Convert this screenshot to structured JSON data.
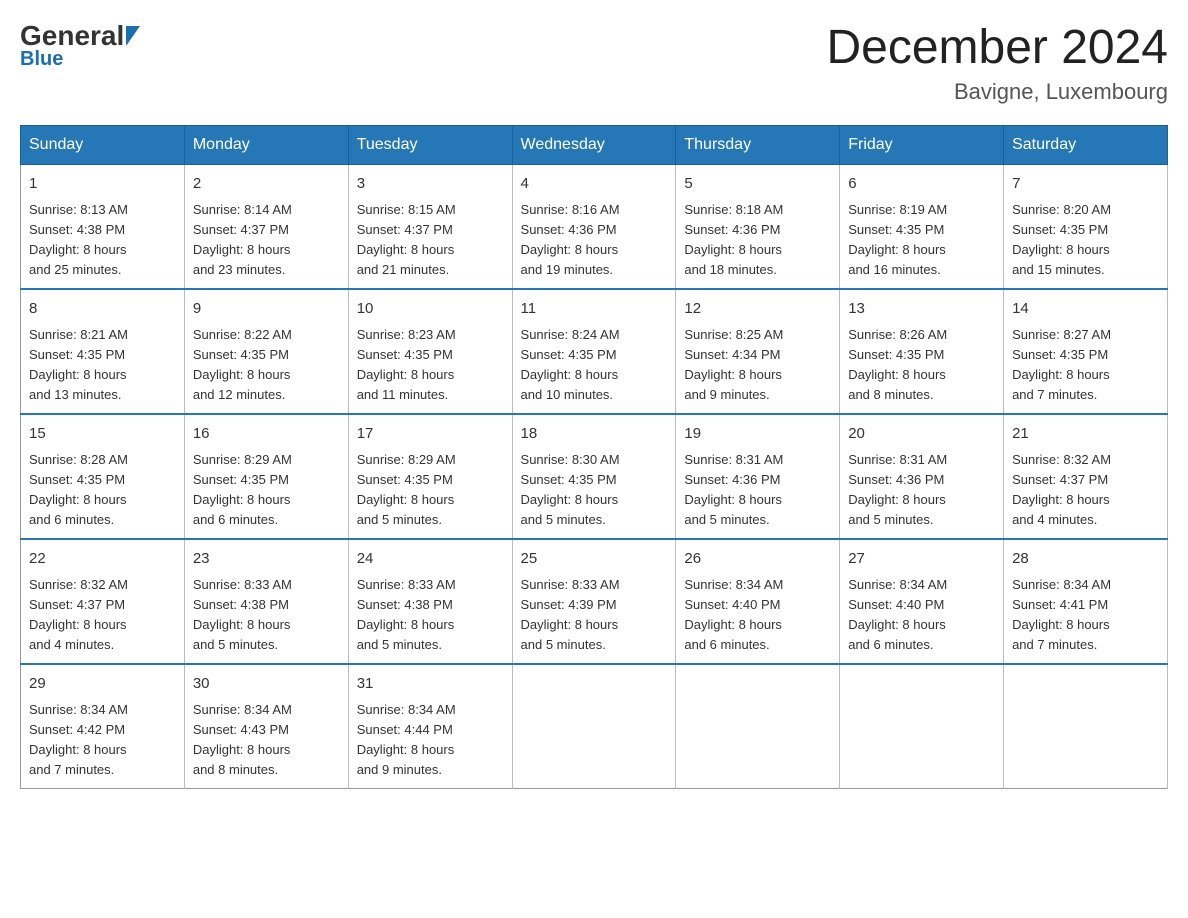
{
  "logo": {
    "general": "General",
    "blue": "Blue"
  },
  "header": {
    "month_year": "December 2024",
    "location": "Bavigne, Luxembourg"
  },
  "weekdays": [
    "Sunday",
    "Monday",
    "Tuesday",
    "Wednesday",
    "Thursday",
    "Friday",
    "Saturday"
  ],
  "weeks": [
    [
      {
        "day": "1",
        "sunrise": "8:13 AM",
        "sunset": "4:38 PM",
        "daylight": "8 hours and 25 minutes."
      },
      {
        "day": "2",
        "sunrise": "8:14 AM",
        "sunset": "4:37 PM",
        "daylight": "8 hours and 23 minutes."
      },
      {
        "day": "3",
        "sunrise": "8:15 AM",
        "sunset": "4:37 PM",
        "daylight": "8 hours and 21 minutes."
      },
      {
        "day": "4",
        "sunrise": "8:16 AM",
        "sunset": "4:36 PM",
        "daylight": "8 hours and 19 minutes."
      },
      {
        "day": "5",
        "sunrise": "8:18 AM",
        "sunset": "4:36 PM",
        "daylight": "8 hours and 18 minutes."
      },
      {
        "day": "6",
        "sunrise": "8:19 AM",
        "sunset": "4:35 PM",
        "daylight": "8 hours and 16 minutes."
      },
      {
        "day": "7",
        "sunrise": "8:20 AM",
        "sunset": "4:35 PM",
        "daylight": "8 hours and 15 minutes."
      }
    ],
    [
      {
        "day": "8",
        "sunrise": "8:21 AM",
        "sunset": "4:35 PM",
        "daylight": "8 hours and 13 minutes."
      },
      {
        "day": "9",
        "sunrise": "8:22 AM",
        "sunset": "4:35 PM",
        "daylight": "8 hours and 12 minutes."
      },
      {
        "day": "10",
        "sunrise": "8:23 AM",
        "sunset": "4:35 PM",
        "daylight": "8 hours and 11 minutes."
      },
      {
        "day": "11",
        "sunrise": "8:24 AM",
        "sunset": "4:35 PM",
        "daylight": "8 hours and 10 minutes."
      },
      {
        "day": "12",
        "sunrise": "8:25 AM",
        "sunset": "4:34 PM",
        "daylight": "8 hours and 9 minutes."
      },
      {
        "day": "13",
        "sunrise": "8:26 AM",
        "sunset": "4:35 PM",
        "daylight": "8 hours and 8 minutes."
      },
      {
        "day": "14",
        "sunrise": "8:27 AM",
        "sunset": "4:35 PM",
        "daylight": "8 hours and 7 minutes."
      }
    ],
    [
      {
        "day": "15",
        "sunrise": "8:28 AM",
        "sunset": "4:35 PM",
        "daylight": "8 hours and 6 minutes."
      },
      {
        "day": "16",
        "sunrise": "8:29 AM",
        "sunset": "4:35 PM",
        "daylight": "8 hours and 6 minutes."
      },
      {
        "day": "17",
        "sunrise": "8:29 AM",
        "sunset": "4:35 PM",
        "daylight": "8 hours and 5 minutes."
      },
      {
        "day": "18",
        "sunrise": "8:30 AM",
        "sunset": "4:35 PM",
        "daylight": "8 hours and 5 minutes."
      },
      {
        "day": "19",
        "sunrise": "8:31 AM",
        "sunset": "4:36 PM",
        "daylight": "8 hours and 5 minutes."
      },
      {
        "day": "20",
        "sunrise": "8:31 AM",
        "sunset": "4:36 PM",
        "daylight": "8 hours and 5 minutes."
      },
      {
        "day": "21",
        "sunrise": "8:32 AM",
        "sunset": "4:37 PM",
        "daylight": "8 hours and 4 minutes."
      }
    ],
    [
      {
        "day": "22",
        "sunrise": "8:32 AM",
        "sunset": "4:37 PM",
        "daylight": "8 hours and 4 minutes."
      },
      {
        "day": "23",
        "sunrise": "8:33 AM",
        "sunset": "4:38 PM",
        "daylight": "8 hours and 5 minutes."
      },
      {
        "day": "24",
        "sunrise": "8:33 AM",
        "sunset": "4:38 PM",
        "daylight": "8 hours and 5 minutes."
      },
      {
        "day": "25",
        "sunrise": "8:33 AM",
        "sunset": "4:39 PM",
        "daylight": "8 hours and 5 minutes."
      },
      {
        "day": "26",
        "sunrise": "8:34 AM",
        "sunset": "4:40 PM",
        "daylight": "8 hours and 6 minutes."
      },
      {
        "day": "27",
        "sunrise": "8:34 AM",
        "sunset": "4:40 PM",
        "daylight": "8 hours and 6 minutes."
      },
      {
        "day": "28",
        "sunrise": "8:34 AM",
        "sunset": "4:41 PM",
        "daylight": "8 hours and 7 minutes."
      }
    ],
    [
      {
        "day": "29",
        "sunrise": "8:34 AM",
        "sunset": "4:42 PM",
        "daylight": "8 hours and 7 minutes."
      },
      {
        "day": "30",
        "sunrise": "8:34 AM",
        "sunset": "4:43 PM",
        "daylight": "8 hours and 8 minutes."
      },
      {
        "day": "31",
        "sunrise": "8:34 AM",
        "sunset": "4:44 PM",
        "daylight": "8 hours and 9 minutes."
      },
      null,
      null,
      null,
      null
    ]
  ],
  "labels": {
    "sunrise": "Sunrise:",
    "sunset": "Sunset:",
    "daylight": "Daylight:"
  }
}
